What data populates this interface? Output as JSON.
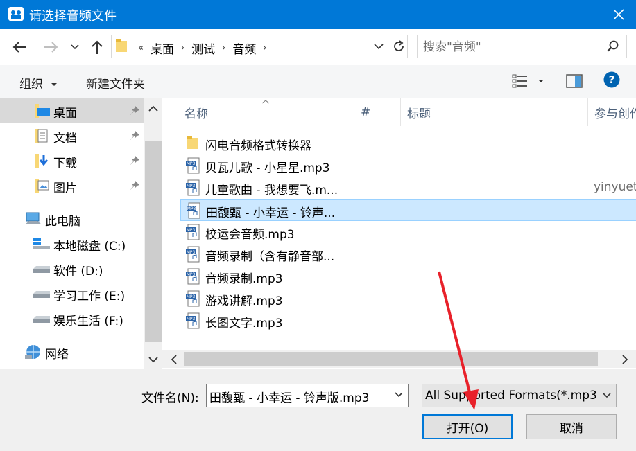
{
  "window": {
    "title": "请选择音频文件"
  },
  "address": {
    "overflow": "«",
    "crumbs": [
      "桌面",
      "测试",
      "音频"
    ]
  },
  "search": {
    "placeholder": "搜索\"音频\""
  },
  "toolbar": {
    "organize": "组织",
    "new_folder": "新建文件夹",
    "help": "?"
  },
  "sidebar": {
    "items": [
      {
        "label": "桌面",
        "icon": "desktop-folder-icon",
        "pinned": true,
        "selected": true
      },
      {
        "label": "文档",
        "icon": "documents-icon",
        "pinned": true
      },
      {
        "label": "下载",
        "icon": "downloads-icon",
        "pinned": true
      },
      {
        "label": "图片",
        "icon": "pictures-icon",
        "pinned": true
      },
      {
        "label": "此电脑",
        "icon": "computer-icon"
      },
      {
        "label": "本地磁盘 (C:)",
        "icon": "windows-drive-icon"
      },
      {
        "label": "软件 (D:)",
        "icon": "drive-icon"
      },
      {
        "label": "学习工作 (E:)",
        "icon": "drive-icon"
      },
      {
        "label": "娱乐生活 (F:)",
        "icon": "drive-icon"
      },
      {
        "label": "网络",
        "icon": "network-icon"
      }
    ]
  },
  "columns": {
    "name": "名称",
    "number": "#",
    "title": "标题",
    "contributor": "参与创作"
  },
  "files": [
    {
      "name": "闪电音频格式转换器",
      "type": "folder",
      "contributor": ""
    },
    {
      "name": "贝瓦儿歌 - 小星星.mp3",
      "type": "mp3",
      "contributor": ""
    },
    {
      "name": "儿童歌曲 - 我想要飞.m...",
      "type": "mp3",
      "contributor": "yinyuetai"
    },
    {
      "name": "田馥甄 - 小幸运 - 铃声...",
      "type": "mp3",
      "contributor": "",
      "selected": true
    },
    {
      "name": "校运会音频.mp3",
      "type": "mp3",
      "contributor": ""
    },
    {
      "name": "音频录制（含有静音部...",
      "type": "mp3",
      "contributor": ""
    },
    {
      "name": "音频录制.mp3",
      "type": "mp3",
      "contributor": ""
    },
    {
      "name": "游戏讲解.mp3",
      "type": "mp3",
      "contributor": ""
    },
    {
      "name": "长图文字.mp3",
      "type": "mp3",
      "contributor": ""
    }
  ],
  "bottom": {
    "filename_label": "文件名(N):",
    "filename_value": "田馥甄 - 小幸运 - 铃声版.mp3",
    "filetype_value": "All Supported Formats(*.mp3",
    "open_label": "打开(O)",
    "cancel_label": "取消"
  },
  "colors": {
    "accent": "#0078d7",
    "selection": "#cce8ff",
    "arrow": "#e8212a"
  }
}
